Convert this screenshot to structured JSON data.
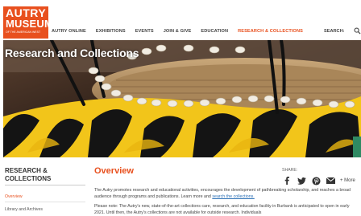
{
  "logo": {
    "line1": "AUTRY",
    "line2": "MUSEUM",
    "tagline": "OF THE AMERICAN WEST",
    "bg_color": "#e8501e"
  },
  "nav": {
    "items": [
      {
        "label": "AUTRY ONLINE",
        "active": false
      },
      {
        "label": "EXHIBITIONS",
        "active": false
      },
      {
        "label": "EVENTS",
        "active": false
      },
      {
        "label": "JOIN & GIVE",
        "active": false
      },
      {
        "label": "EDUCATION",
        "active": false
      },
      {
        "label": "RESEARCH & COLLECTIONS",
        "active": true
      }
    ],
    "search_label": "SEARCH:",
    "search_icon": "search-icon",
    "active_color": "#e8501e"
  },
  "hero": {
    "title": "Research and Collections"
  },
  "sidebar": {
    "title": "RESEARCH & COLLECTIONS",
    "items": [
      {
        "label": "Overview",
        "active": true
      },
      {
        "label": "Library and Archives",
        "active": false
      }
    ]
  },
  "main": {
    "heading": "Overview",
    "share": {
      "label": "SHARE:",
      "icons": [
        "facebook-icon",
        "twitter-icon",
        "pinterest-icon",
        "email-icon"
      ],
      "more_label": "+ More"
    },
    "para1_text": "The Autry promotes research and educational activities, encourages the development of pathbreaking scholarship, and reaches a broad audience through programs and publications. Learn more and ",
    "para1_link": "search the collections.",
    "para2_text": "Please note: The Autry's new, state-of-the-art collections care, research, and education facility in Burbank is anticipated to open in early 2021. Until then, the Autry's collections are not available for outside research. Individuals"
  }
}
